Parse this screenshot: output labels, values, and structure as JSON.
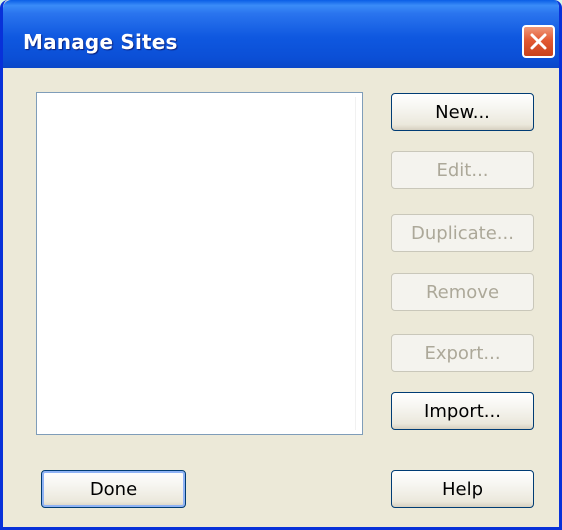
{
  "window": {
    "title": "Manage Sites",
    "close_icon": "close-icon"
  },
  "colors": {
    "titlebar": "#0b4fd6",
    "close_button": "#e35a34",
    "dialog_background": "#ece9d8",
    "disabled_text": "#aca899"
  },
  "site_list": {
    "items": []
  },
  "buttons": {
    "new": "New...",
    "edit": "Edit...",
    "duplicate": "Duplicate...",
    "remove": "Remove",
    "export": "Export...",
    "import": "Import...",
    "done": "Done",
    "help": "Help"
  },
  "button_states": {
    "new": "enabled",
    "edit": "disabled",
    "duplicate": "disabled",
    "remove": "disabled",
    "export": "disabled",
    "import": "enabled",
    "done": "enabled",
    "help": "enabled"
  }
}
